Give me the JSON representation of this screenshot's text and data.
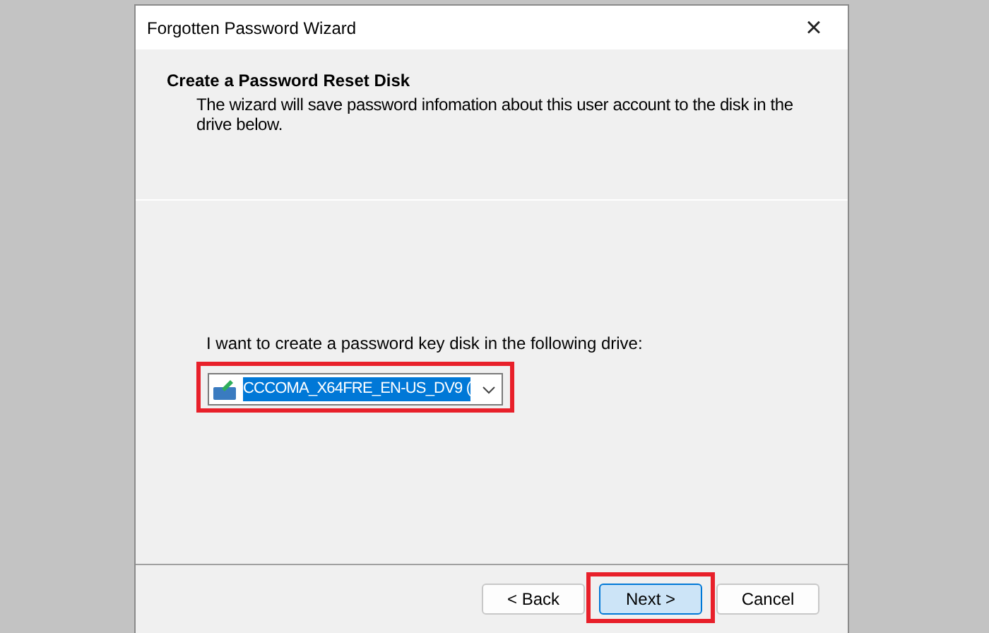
{
  "window": {
    "title": "Forgotten Password Wizard",
    "close": "×"
  },
  "header": {
    "title": "Create a Password Reset Disk",
    "description": "The wizard will save password infomation about this user account to the disk in the drive below."
  },
  "drive_prompt": "I want to create a password key disk in the following drive:",
  "drive_dropdown": {
    "value": "CCCOMA_X64FRE_EN-US_DV9 (",
    "highlighted": true
  },
  "buttons": [
    {
      "label": "< Back",
      "default": false,
      "highlighted": false
    },
    {
      "label": "Next >",
      "default": true,
      "highlighted": true
    },
    {
      "label": "Cancel",
      "default": false,
      "highlighted": false
    }
  ]
}
